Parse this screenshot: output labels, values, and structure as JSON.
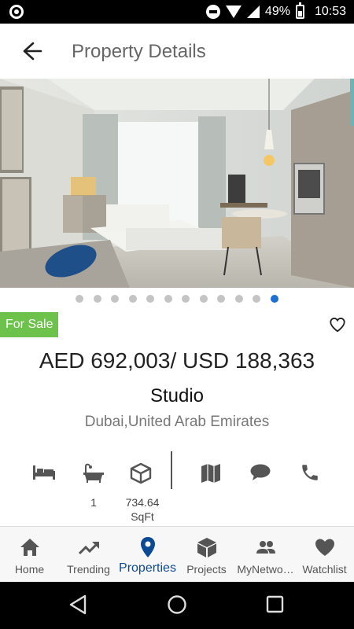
{
  "status_bar": {
    "battery": "49%",
    "time": "10:53"
  },
  "app_bar": {
    "title": "Property Details",
    "back_icon": "arrow-left-icon"
  },
  "gallery": {
    "image_count": 12,
    "active_index": 11
  },
  "listing": {
    "badge": "For Sale",
    "price": "AED 692,003/ USD 188,363",
    "type": "Studio",
    "location": "Dubai,United Arab Emirates"
  },
  "features": {
    "bedrooms_icon": "bed-icon",
    "bathrooms_icon": "bathtub-icon",
    "area_icon": "cube-icon",
    "bathrooms": "1",
    "area_value": "734.64",
    "area_unit": "SqFt"
  },
  "actions": {
    "map_icon": "map-icon",
    "chat_icon": "chat-icon",
    "phone_icon": "phone-icon"
  },
  "bottom_nav": {
    "items": [
      {
        "label": "Home",
        "icon": "home-icon"
      },
      {
        "label": "Trending",
        "icon": "trending-icon"
      },
      {
        "label": "Properties",
        "icon": "location-pin-icon"
      },
      {
        "label": "Projects",
        "icon": "box-icon"
      },
      {
        "label": "MyNetwo…",
        "icon": "people-icon"
      },
      {
        "label": "Watchlist",
        "icon": "heart-icon"
      }
    ],
    "active_index": 2
  },
  "colors": {
    "accent": "#0d4a93",
    "badge": "#6cc24a",
    "dot_active": "#1f6fd1"
  }
}
